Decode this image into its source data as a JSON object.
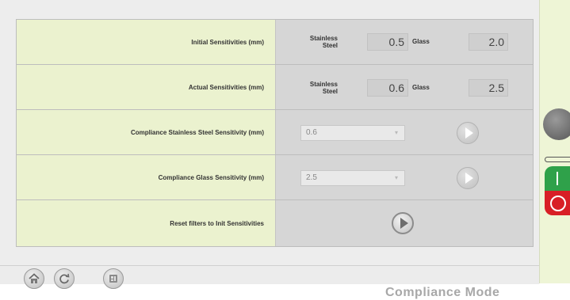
{
  "rows": {
    "initial": {
      "label": "Initial Sensitivities (mm)",
      "steel_label_1": "Stainless",
      "steel_label_2": "Steel",
      "steel_value": "0.5",
      "glass_label": "Glass",
      "glass_value": "2.0"
    },
    "actual": {
      "label": "Actual Sensitivities (mm)",
      "steel_label_1": "Stainless",
      "steel_label_2": "Steel",
      "steel_value": "0.6",
      "glass_label": "Glass",
      "glass_value": "2.5"
    },
    "compliance_steel": {
      "label": "Compliance Stainless Steel Sensitivity (mm)",
      "selected": "0.6"
    },
    "compliance_glass": {
      "label": "Compliance Glass Sensitivity (mm)",
      "selected": "2.5"
    },
    "reset": {
      "label": "Reset filters to Init Sensitivities"
    }
  },
  "footer": {
    "mode_label": "Compliance Mode"
  },
  "icons": {
    "home": "home-icon",
    "refresh": "refresh-icon",
    "settings": "settings-icon",
    "play": "play-icon"
  },
  "colors": {
    "label_bg": "#ebf2cf",
    "value_bg": "#d6d6d6",
    "start_green": "#2fa14a",
    "stop_red": "#d81f26"
  }
}
